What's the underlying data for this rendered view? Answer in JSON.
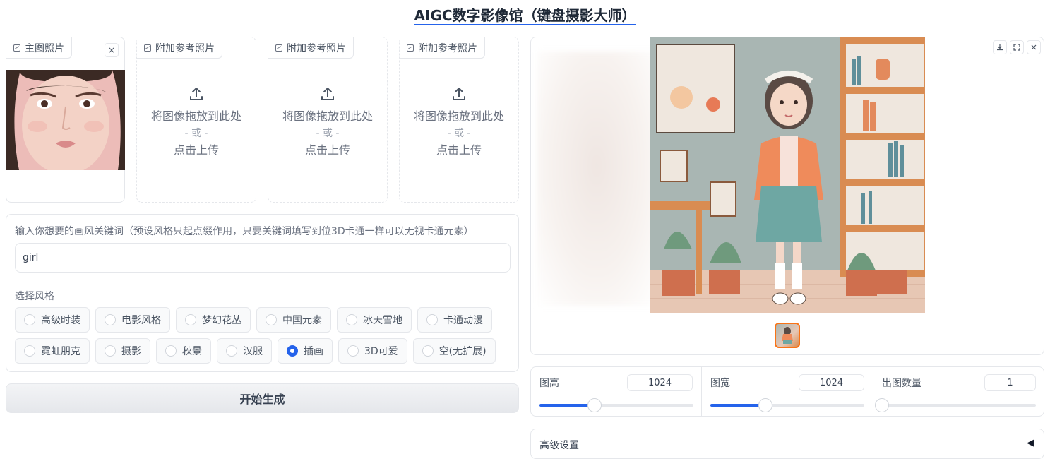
{
  "page": {
    "title": "AIGC数字影像馆（键盘摄影大师）"
  },
  "uploads": {
    "main": {
      "label": "主图照片",
      "close": "×"
    },
    "refs": [
      {
        "label": "附加参考照片",
        "drop": "将图像拖放到此处",
        "or": "- 或 -",
        "click": "点击上传"
      },
      {
        "label": "附加参考照片",
        "drop": "将图像拖放到此处",
        "or": "- 或 -",
        "click": "点击上传"
      },
      {
        "label": "附加参考照片",
        "drop": "将图像拖放到此处",
        "or": "- 或 -",
        "click": "点击上传"
      }
    ]
  },
  "prompt": {
    "label": "输入你想要的画风关键词（预设风格只起点缀作用，只要关键词填写到位3D卡通一样可以无视卡通元素）",
    "value": "girl"
  },
  "style": {
    "label": "选择风格",
    "selected": "插画",
    "row1": [
      "高级时装",
      "电影风格",
      "梦幻花丛",
      "中国元素",
      "冰天雪地",
      "卡通动漫"
    ],
    "row2": [
      "霓虹朋克",
      "摄影",
      "秋景",
      "汉服",
      "插画",
      "3D可爱",
      "空(无扩展)"
    ]
  },
  "generate_label": "开始生成",
  "output": {
    "download_icon": "download-icon",
    "fullscreen_icon": "fullscreen-icon",
    "close_icon": "close-icon"
  },
  "sliders": [
    {
      "label": "图高",
      "value": "1024",
      "fraction": 0.36
    },
    {
      "label": "图宽",
      "value": "1024",
      "fraction": 0.36
    },
    {
      "label": "出图数量",
      "value": "1",
      "fraction": 0.0
    }
  ],
  "advanced": {
    "label": "高级设置",
    "toggle": "◀"
  },
  "colors": {
    "accent": "#2563eb",
    "border": "#e5e7eb"
  }
}
